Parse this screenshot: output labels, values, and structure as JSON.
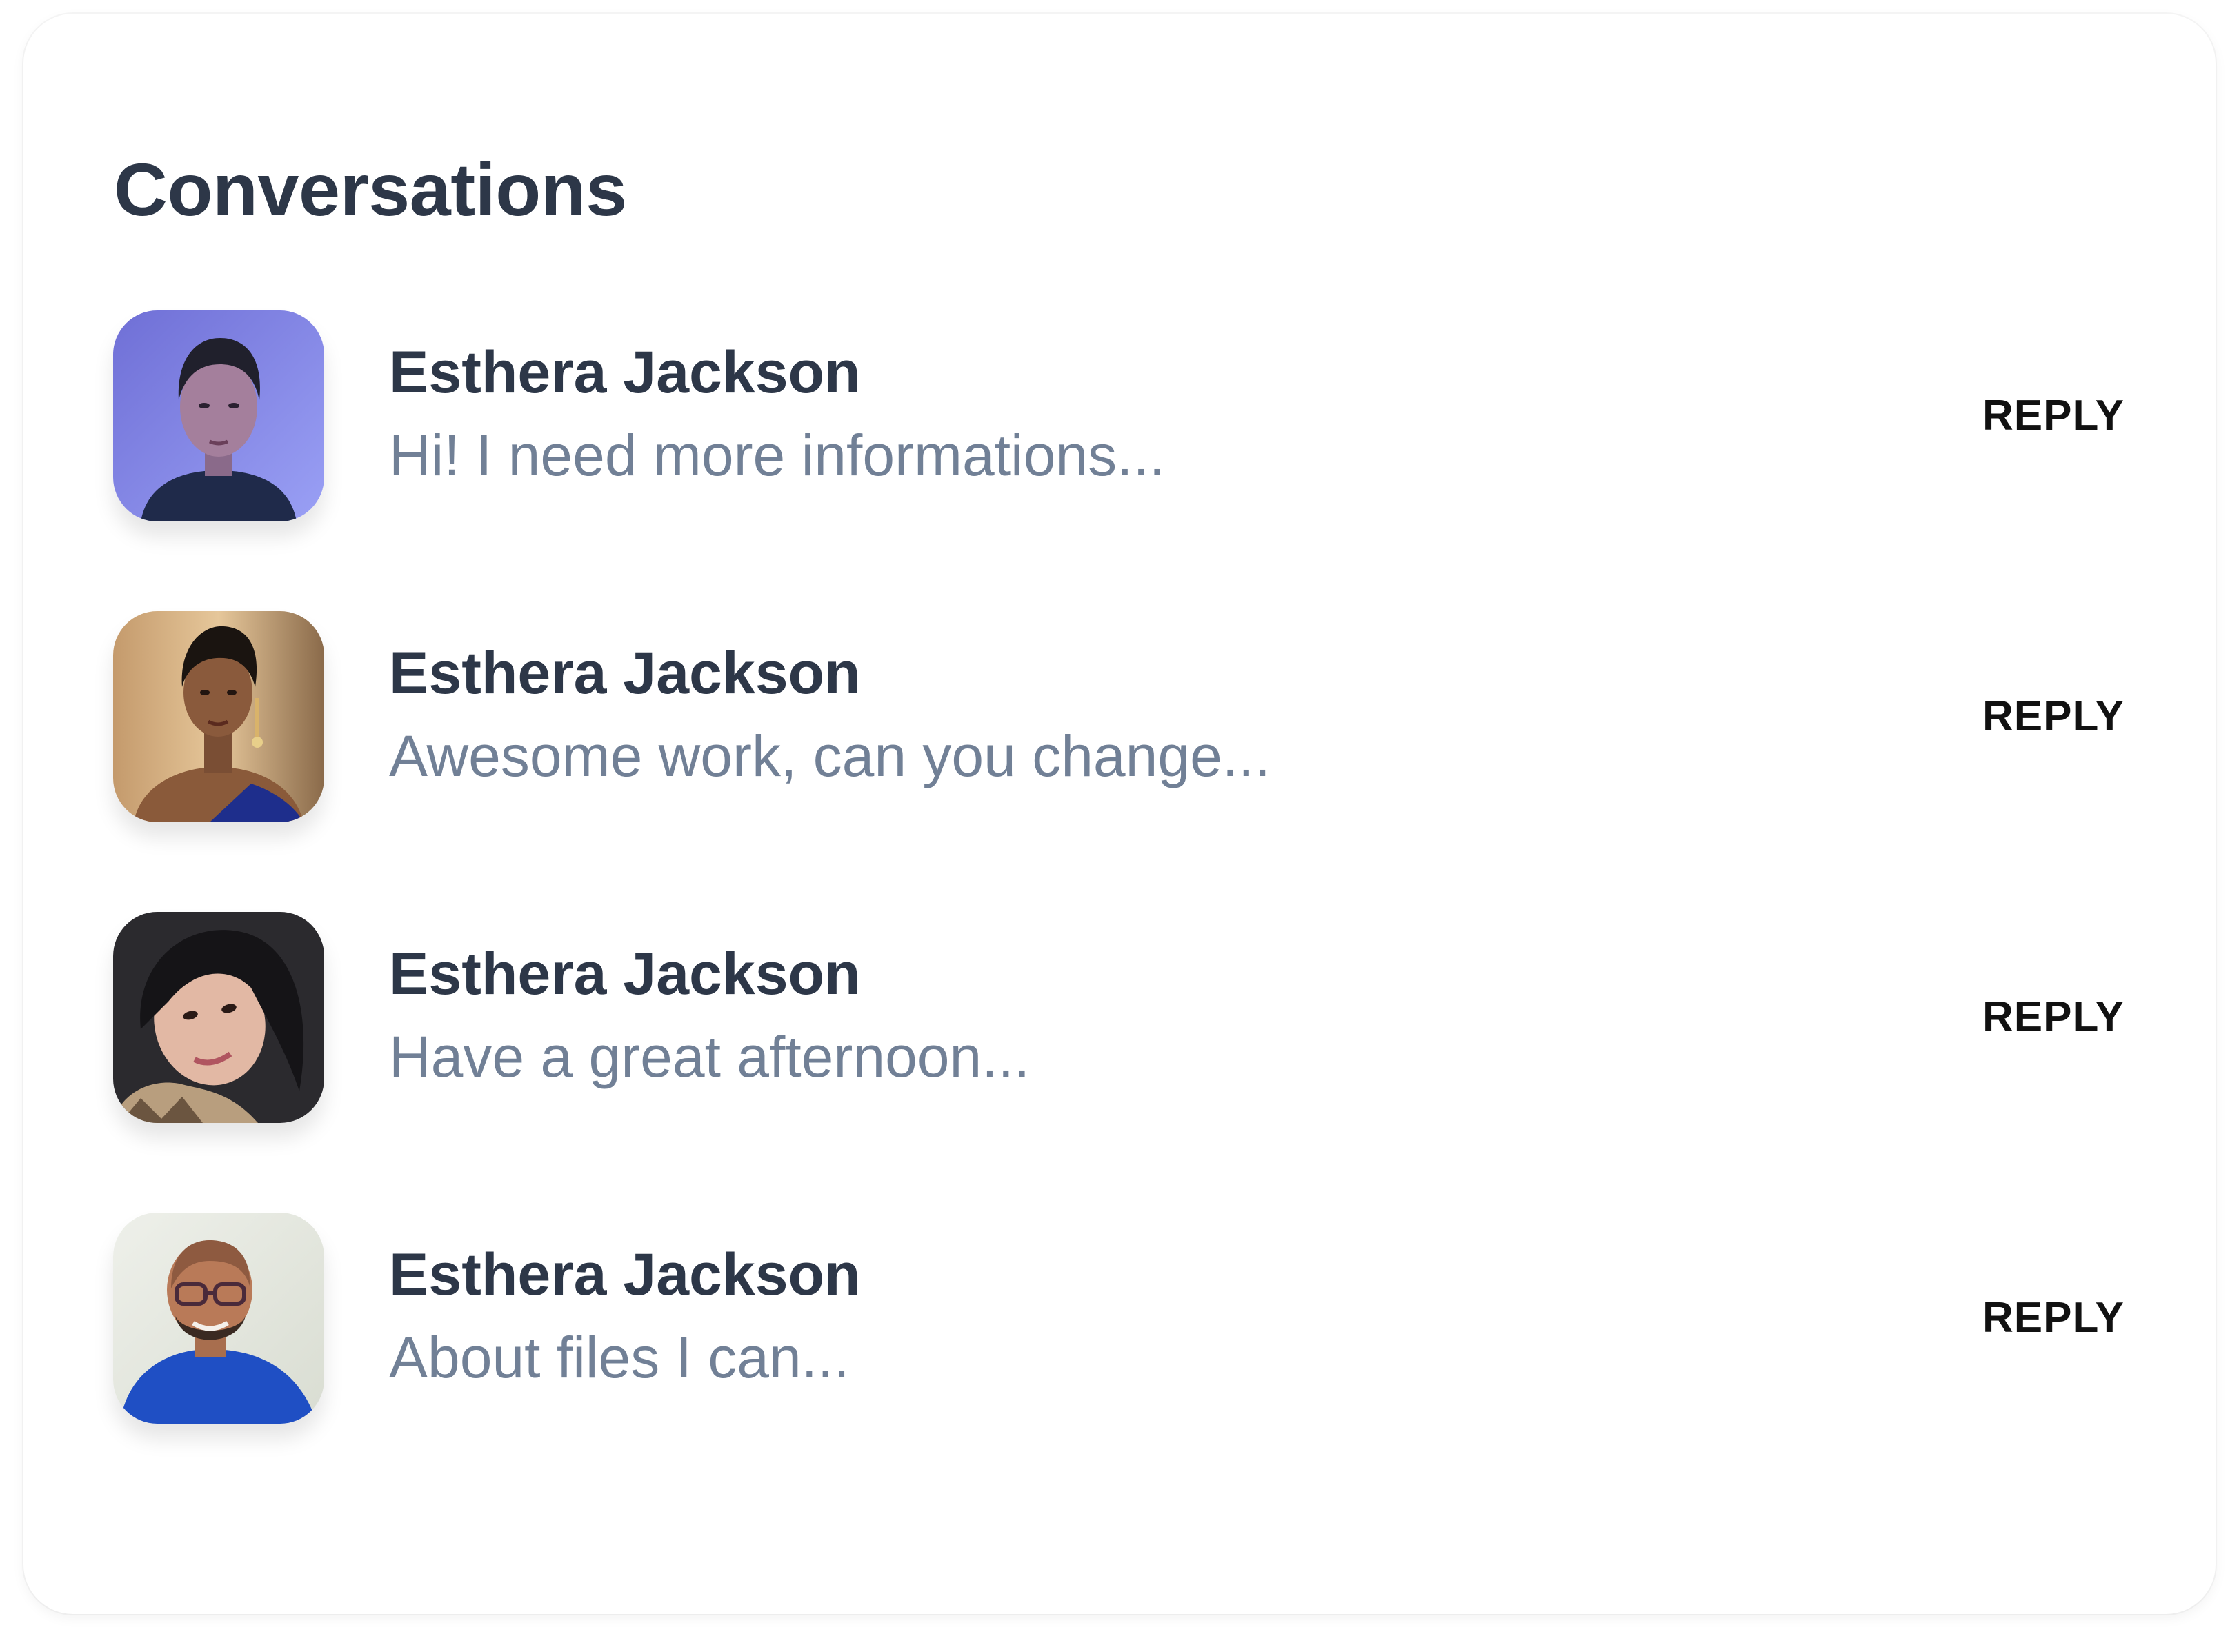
{
  "card": {
    "title": "Conversations"
  },
  "conversations": [
    {
      "name": "Esthera Jackson",
      "message": "Hi! I need more informations...",
      "action_label": "REPLY",
      "avatar_icon": "avatar-photo-woman-purple-background"
    },
    {
      "name": "Esthera Jackson",
      "message": "Awesome work, can you change...",
      "action_label": "REPLY",
      "avatar_icon": "avatar-photo-woman-earrings"
    },
    {
      "name": "Esthera Jackson",
      "message": "Have a great afternoon...",
      "action_label": "REPLY",
      "avatar_icon": "avatar-photo-woman-dark-hair"
    },
    {
      "name": "Esthera Jackson",
      "message": "About files I can...",
      "action_label": "REPLY",
      "avatar_icon": "avatar-photo-man-glasses-blue-shirt"
    }
  ],
  "colors": {
    "heading": "#2d3748",
    "secondary_text": "#718096",
    "action_text": "#111111",
    "card_background": "#ffffff"
  }
}
